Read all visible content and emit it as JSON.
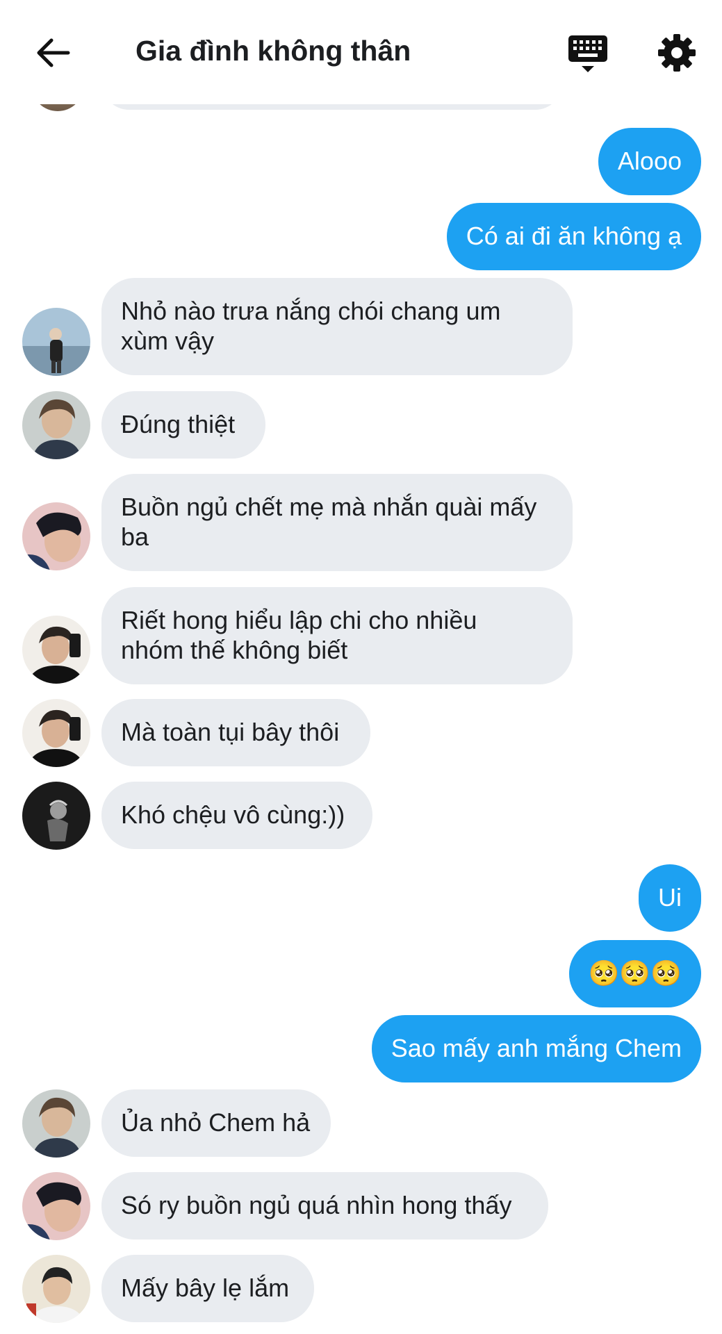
{
  "header": {
    "title": "Gia đình không thân",
    "back_icon": "arrow-left-icon",
    "keyboard_icon": "keyboard-icon",
    "settings_icon": "gear-icon"
  },
  "colors": {
    "outgoing_bubble": "#1da1f2",
    "incoming_bubble": "#e9ecf0",
    "background": "#ffffff"
  },
  "messages": [
    {
      "direction": "out",
      "text": "Alooo"
    },
    {
      "direction": "out",
      "text": "Có ai đi ăn không ạ"
    },
    {
      "direction": "in",
      "text": "Nhỏ nào trưa nắng chói chang um\nxùm vậy"
    },
    {
      "direction": "in",
      "text": "Đúng thiệt"
    },
    {
      "direction": "in",
      "text": "Buồn ngủ chết mẹ mà nhắn quài mấy\nba"
    },
    {
      "direction": "in",
      "text": "Riết hong hiểu lập chi cho nhiều\nnhóm thế không biết"
    },
    {
      "direction": "in",
      "text": "Mà toàn tụi bây thôi"
    },
    {
      "direction": "in",
      "text": "Khó chệu vô cùng:))"
    },
    {
      "direction": "out",
      "text": "Ui"
    },
    {
      "direction": "out",
      "text": "🥺🥺🥺"
    },
    {
      "direction": "out",
      "text": "Sao mấy anh mắng Chem"
    },
    {
      "direction": "in",
      "text": "Ủa nhỏ Chem hả"
    },
    {
      "direction": "in",
      "text": "Só ry buồn ngủ quá nhìn hong thấy"
    },
    {
      "direction": "in",
      "text": "Mấy bây lẹ lắm"
    }
  ]
}
